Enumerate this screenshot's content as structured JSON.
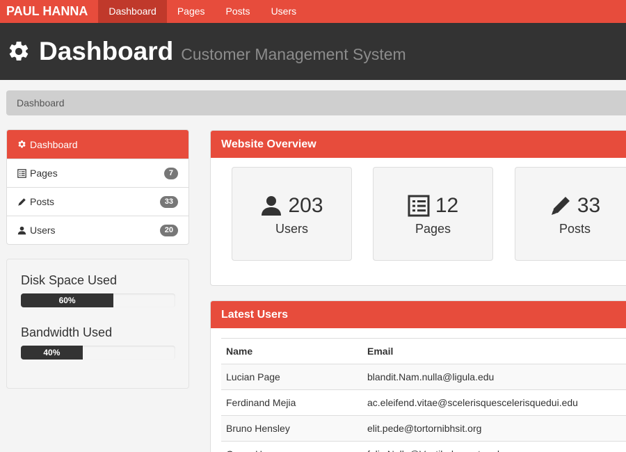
{
  "navbar": {
    "brand": "PAUL HANNA",
    "items": [
      {
        "label": "Dashboard",
        "active": true
      },
      {
        "label": "Pages"
      },
      {
        "label": "Posts"
      },
      {
        "label": "Users"
      }
    ]
  },
  "header": {
    "title": "Dashboard",
    "subtitle": "Customer Management System",
    "icon": "gear-icon"
  },
  "breadcrumb": "Dashboard",
  "sidebar": {
    "items": [
      {
        "label": "Dashboard",
        "icon": "gear-icon",
        "active": true
      },
      {
        "label": "Pages",
        "icon": "list-icon",
        "count": "7"
      },
      {
        "label": "Posts",
        "icon": "pencil-icon",
        "count": "33"
      },
      {
        "label": "Users",
        "icon": "user-icon",
        "count": "20"
      }
    ]
  },
  "usage": {
    "disk": {
      "label": "Disk Space Used",
      "percent": 60,
      "text": "60%"
    },
    "bandwidth": {
      "label": "Bandwidth Used",
      "percent": 40,
      "text": "40%"
    }
  },
  "overview": {
    "title": "Website Overview",
    "stats": [
      {
        "icon": "user-icon",
        "value": "203",
        "label": "Users"
      },
      {
        "icon": "list-icon",
        "value": "12",
        "label": "Pages"
      },
      {
        "icon": "pencil-icon",
        "value": "33",
        "label": "Posts"
      }
    ]
  },
  "latest_users": {
    "title": "Latest Users",
    "columns": [
      "Name",
      "Email"
    ],
    "rows": [
      {
        "name": "Lucian Page",
        "email": "blandit.Nam.nulla@ligula.edu"
      },
      {
        "name": "Ferdinand Mejia",
        "email": "ac.eleifend.vitae@scelerisquescelerisquedui.edu"
      },
      {
        "name": "Bruno Hensley",
        "email": "elit.pede@tortornibhsit.org"
      },
      {
        "name": "Orson Hopper",
        "email": "felis.Nulla@Vestibulumante.edu"
      }
    ]
  },
  "colors": {
    "accent": "#e74c3c",
    "accent_dark": "#c0392b",
    "header_bg": "#333333"
  }
}
